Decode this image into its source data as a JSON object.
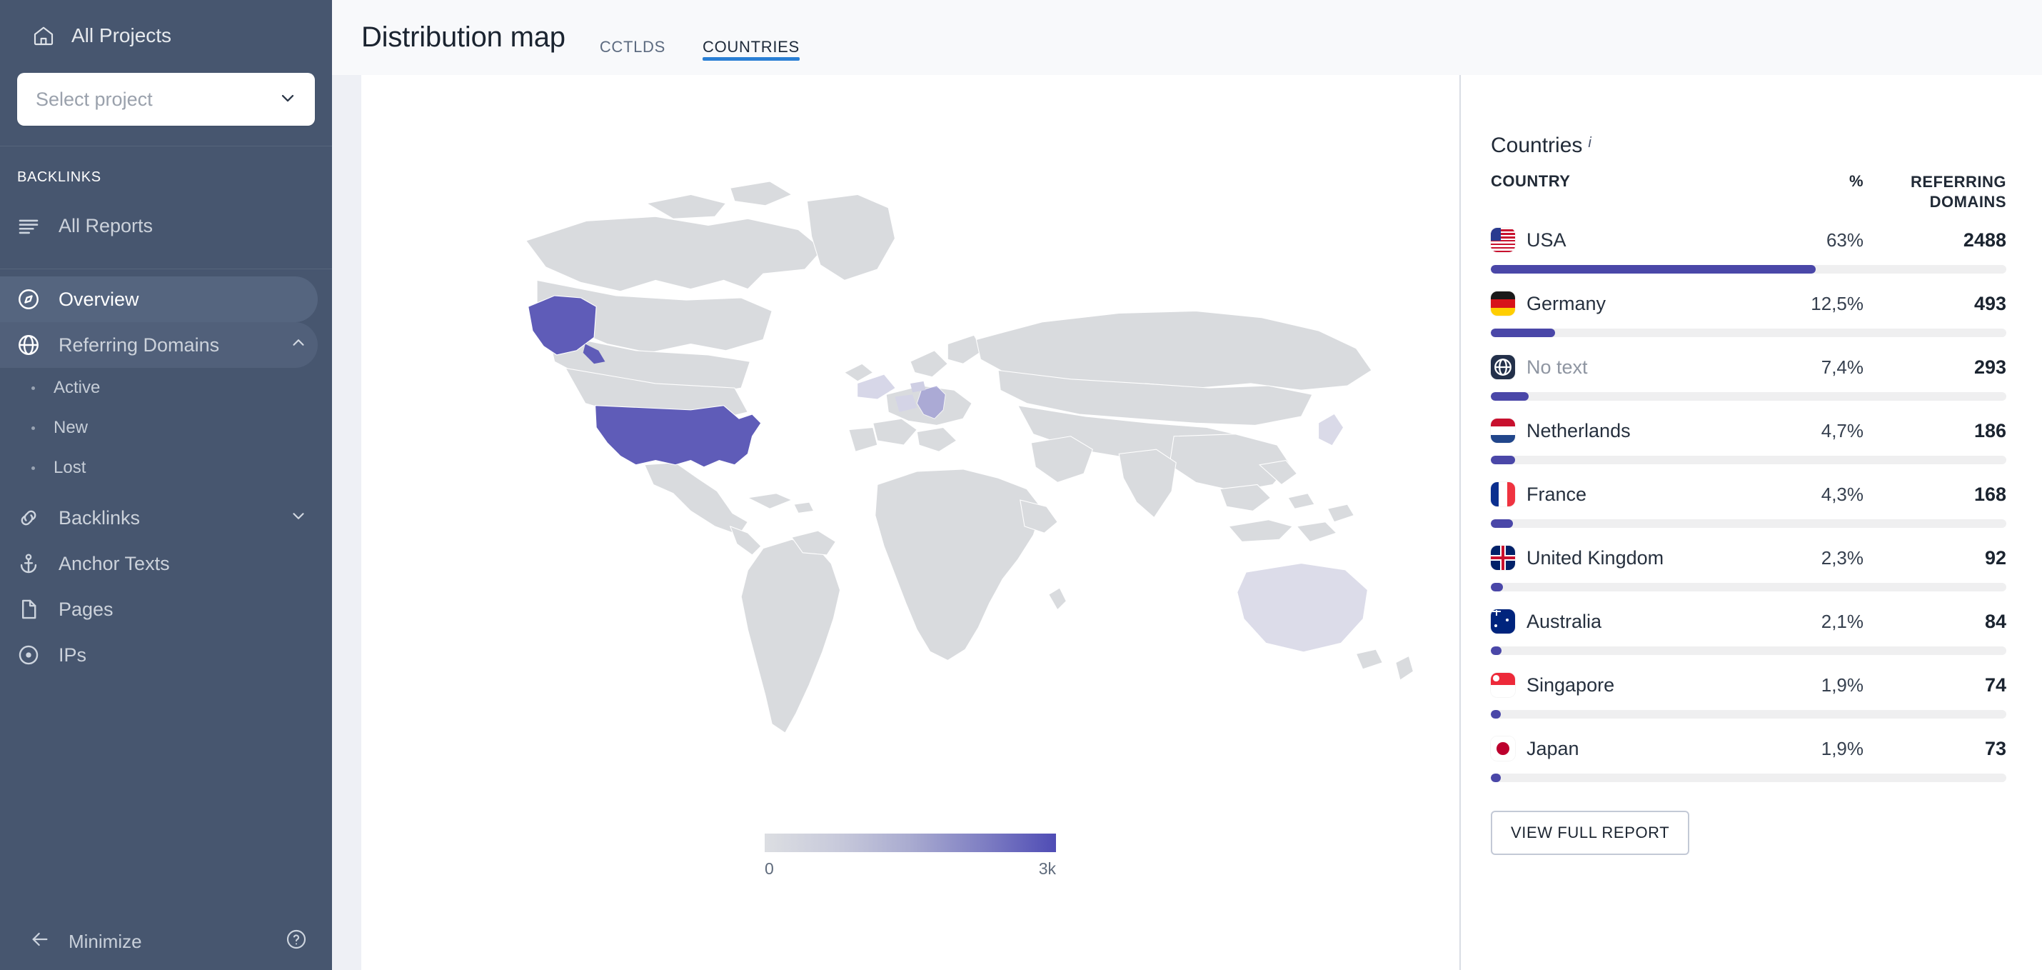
{
  "sidebar": {
    "home_label": "All Projects",
    "project_select": {
      "placeholder": "Select project"
    },
    "section_label": "BACKLINKS",
    "all_reports_label": "All Reports",
    "items": [
      {
        "label": "Overview",
        "icon": "compass-icon",
        "active": true
      },
      {
        "label": "Referring Domains",
        "icon": "globe-icon",
        "expanded": true
      },
      {
        "label": "Backlinks",
        "icon": "link-icon",
        "expanded": false
      },
      {
        "label": "Anchor Texts",
        "icon": "anchor-icon"
      },
      {
        "label": "Pages",
        "icon": "document-icon"
      },
      {
        "label": "IPs",
        "icon": "target-icon"
      }
    ],
    "subitems": [
      "Active",
      "New",
      "Lost"
    ],
    "minimize_label": "Minimize",
    "help_label": "?"
  },
  "header": {
    "title": "Distribution map",
    "tabs": [
      {
        "label": "CCTLDS",
        "active": false
      },
      {
        "label": "COUNTRIES",
        "active": true
      }
    ]
  },
  "map": {
    "legend": {
      "min": "0",
      "max": "3k"
    },
    "highlight_color": "#5f5cb8",
    "base_color": "#d9dbde"
  },
  "panel": {
    "title": "Countries",
    "info_glyph": "i",
    "columns": {
      "country": "COUNTRY",
      "percent": "%",
      "referring": "REFERRING DOMAINS"
    },
    "view_full_report": "VIEW FULL REPORT",
    "accent_color": "#4a47a8"
  },
  "chart_data": {
    "type": "bar",
    "title": "Countries",
    "xlabel": "",
    "ylabel": "Referring Domains",
    "categories": [
      "USA",
      "Germany",
      "No text",
      "Netherlands",
      "France",
      "United Kingdom",
      "Australia",
      "Singapore",
      "Japan"
    ],
    "values": [
      2488,
      493,
      293,
      186,
      168,
      92,
      84,
      74,
      73
    ],
    "percent_labels": [
      "63%",
      "12,5%",
      "7,4%",
      "4,7%",
      "4,3%",
      "2,3%",
      "2,1%",
      "1,9%",
      "1,9%"
    ],
    "percents": [
      63,
      12.5,
      7.4,
      4.7,
      4.3,
      2.3,
      2.1,
      1.9,
      1.9
    ],
    "value_labels": [
      "2488",
      "493",
      "293",
      "186",
      "168",
      "92",
      "84",
      "74",
      "73"
    ],
    "flags": [
      "us",
      "de",
      "none",
      "nl",
      "fr",
      "gb",
      "au",
      "sg",
      "jp"
    ],
    "ylim": [
      0,
      3000
    ],
    "legend_position": "none",
    "grid": false
  },
  "rows": [
    {
      "name": "USA",
      "pct": "63%",
      "ref": "2488",
      "fill": 63,
      "flag": "us",
      "muted": false
    },
    {
      "name": "Germany",
      "pct": "12,5%",
      "ref": "493",
      "fill": 12.5,
      "flag": "de",
      "muted": false
    },
    {
      "name": "No text",
      "pct": "7,4%",
      "ref": "293",
      "fill": 7.4,
      "flag": "none",
      "muted": true
    },
    {
      "name": "Netherlands",
      "pct": "4,7%",
      "ref": "186",
      "fill": 4.7,
      "flag": "nl",
      "muted": false
    },
    {
      "name": "France",
      "pct": "4,3%",
      "ref": "168",
      "fill": 4.3,
      "flag": "fr",
      "muted": false
    },
    {
      "name": "United Kingdom",
      "pct": "2,3%",
      "ref": "92",
      "fill": 2.3,
      "flag": "gb",
      "muted": false
    },
    {
      "name": "Australia",
      "pct": "2,1%",
      "ref": "84",
      "fill": 2.1,
      "flag": "au",
      "muted": false
    },
    {
      "name": "Singapore",
      "pct": "1,9%",
      "ref": "74",
      "fill": 1.9,
      "flag": "sg",
      "muted": false
    },
    {
      "name": "Japan",
      "pct": "1,9%",
      "ref": "73",
      "fill": 1.9,
      "flag": "jp",
      "muted": false
    }
  ]
}
